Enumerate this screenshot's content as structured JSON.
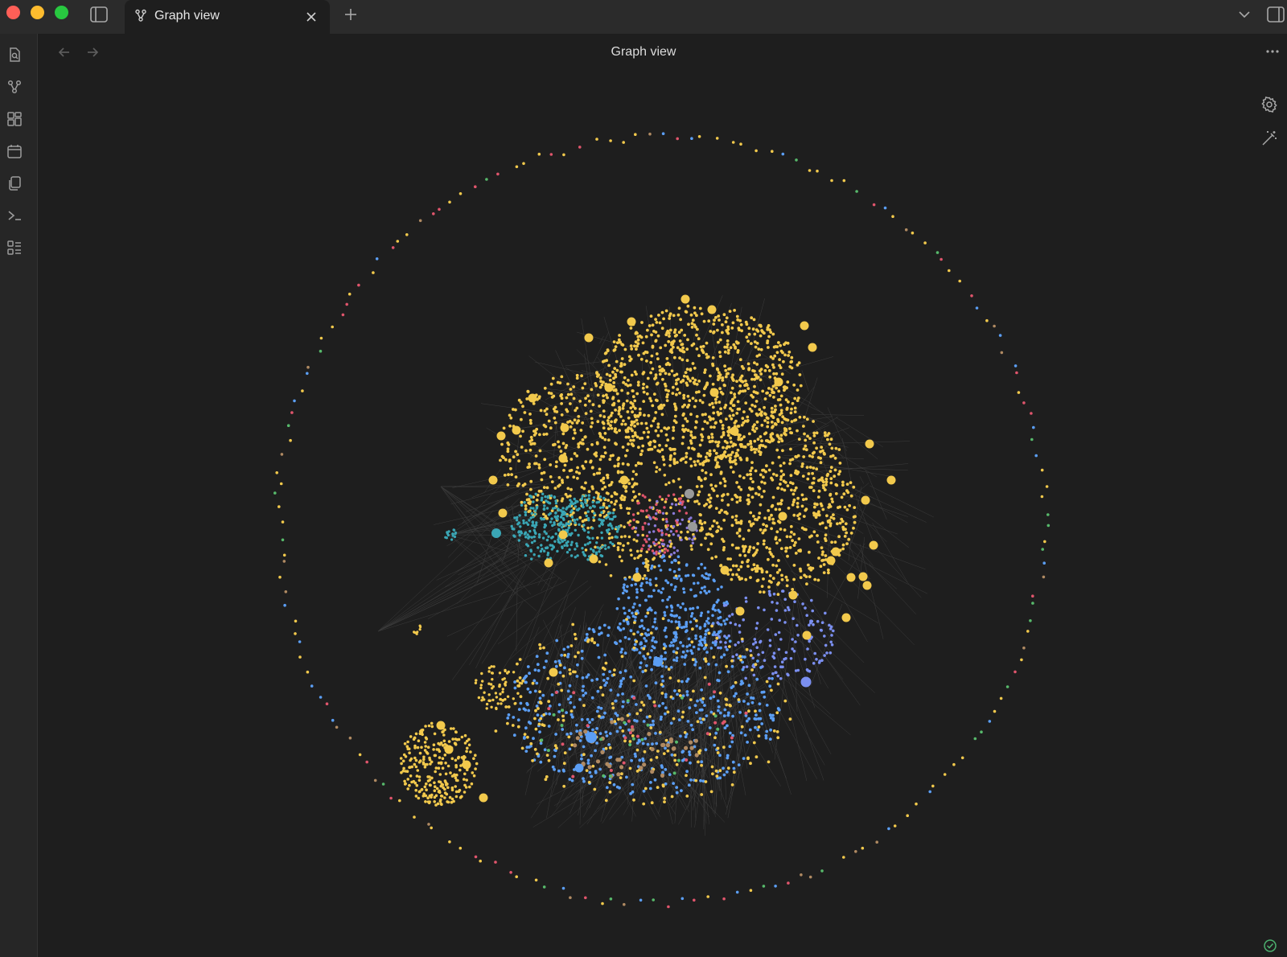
{
  "window": {
    "controls": [
      "close",
      "minimize",
      "zoom"
    ]
  },
  "tab": {
    "label": "Graph view",
    "icon": "git-fork-icon"
  },
  "view": {
    "title": "Graph view",
    "icons": [
      "arrow-left-icon",
      "arrow-right-icon",
      "more-horizontal-icon",
      "gear-icon",
      "wand-icon"
    ]
  },
  "ribbon": {
    "items": [
      "search-file-icon",
      "graph-icon",
      "canvas-grid-icon",
      "calendar-icon",
      "copy-files-icon",
      "terminal-icon",
      "list-icon"
    ]
  },
  "status": {
    "sync_icon": "sync-check-icon"
  },
  "colors": {
    "background": "#1e1e1e",
    "node_yellow": "#f2c94c",
    "node_blue": "#5b9ef4",
    "node_teal": "#3aa6b5",
    "node_pink": "#e0556c",
    "node_green": "#57b96b",
    "node_brown": "#b08a62",
    "node_gray": "#9a9a9a",
    "edge": "#555555"
  }
}
